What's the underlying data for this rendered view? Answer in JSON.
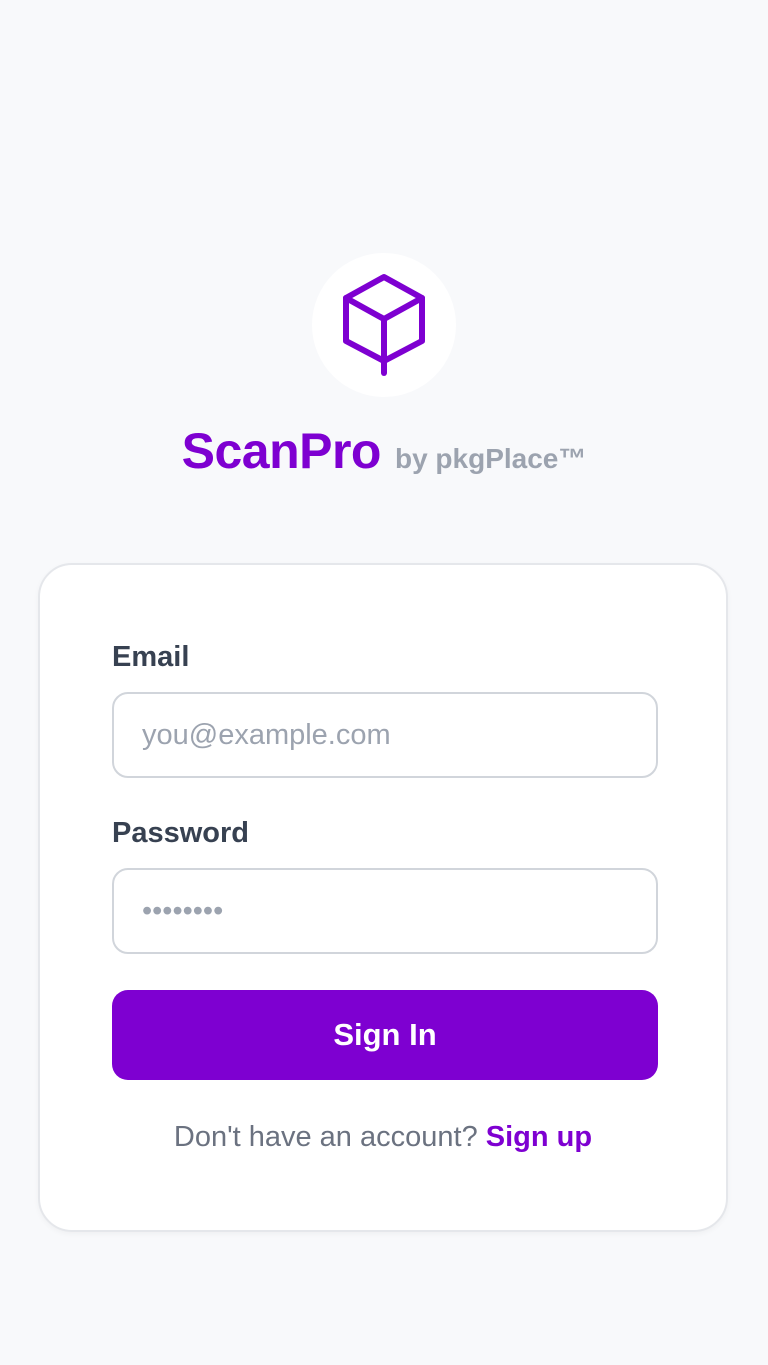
{
  "colors": {
    "brand": "#7e00d1",
    "background": "#f8f9fb",
    "muted": "#9ca3af"
  },
  "logo": {
    "icon": "package-box-icon"
  },
  "brand": {
    "name": "ScanPro",
    "byline": "by pkgPlace™"
  },
  "form": {
    "email": {
      "label": "Email",
      "placeholder": "you@example.com",
      "value": ""
    },
    "password": {
      "label": "Password",
      "placeholder": "••••••••",
      "value": ""
    },
    "submit_label": "Sign In",
    "signup_prompt": "Don't have an account?",
    "signup_link": "Sign up"
  }
}
